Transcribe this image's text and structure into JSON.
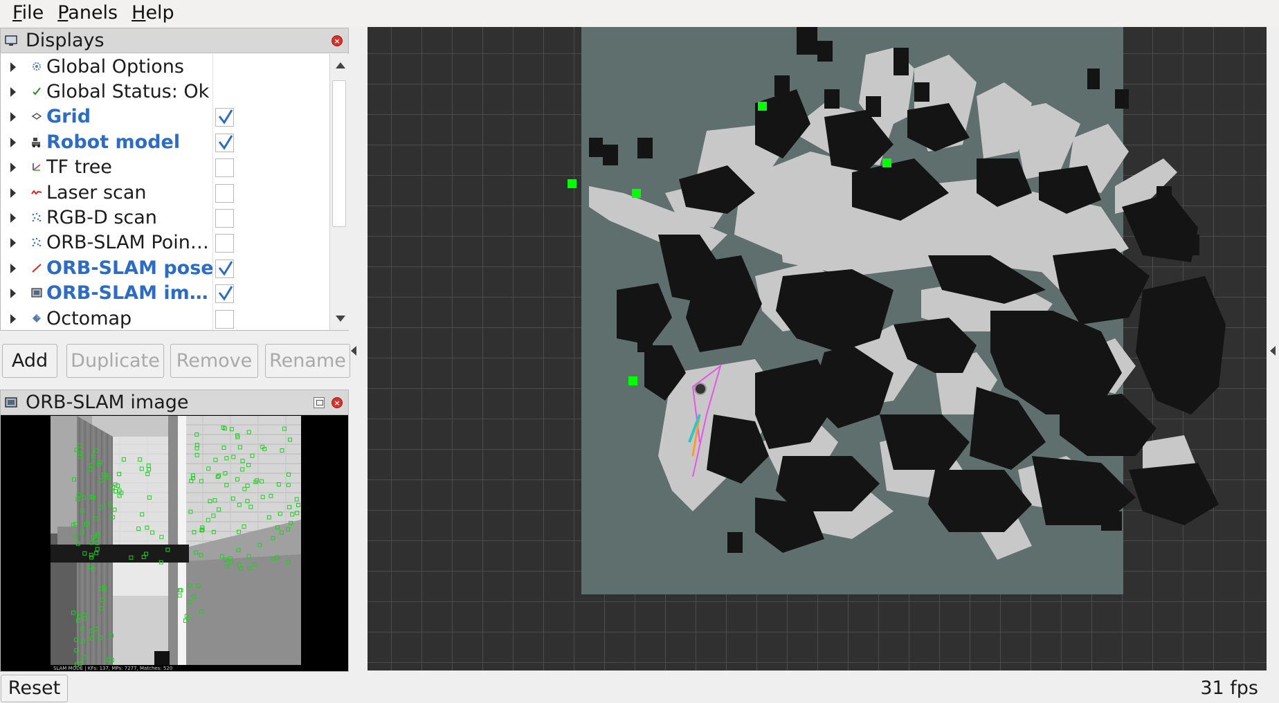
{
  "menubar": {
    "items": [
      {
        "mnemonic": "F",
        "rest": "ile"
      },
      {
        "mnemonic": "P",
        "rest": "anels"
      },
      {
        "mnemonic": "H",
        "rest": "elp"
      }
    ]
  },
  "displays": {
    "title": "Displays",
    "items": [
      {
        "label": "Global Options",
        "icon": "gear-icon",
        "enabled": null
      },
      {
        "label": "Global Status: Ok",
        "icon": "checkmark-icon",
        "enabled": null
      },
      {
        "label": "Grid",
        "icon": "grid-icon",
        "enabled": true
      },
      {
        "label": "Robot model",
        "icon": "robot-icon",
        "enabled": true
      },
      {
        "label": "TF tree",
        "icon": "axes-icon",
        "enabled": false
      },
      {
        "label": "Laser scan",
        "icon": "laser-scan-icon",
        "enabled": false
      },
      {
        "label": "RGB-D scan",
        "icon": "point-cloud-icon",
        "enabled": false
      },
      {
        "label": "ORB-SLAM Poin…",
        "icon": "point-cloud-icon",
        "enabled": false
      },
      {
        "label": "ORB-SLAM pose",
        "icon": "pose-arrow-icon",
        "enabled": true
      },
      {
        "label": "ORB-SLAM im…",
        "icon": "image-icon",
        "enabled": true
      },
      {
        "label": "Octomap",
        "icon": "octomap-icon",
        "enabled": false
      }
    ],
    "buttons": {
      "add": "Add",
      "duplicate": "Duplicate",
      "remove": "Remove",
      "rename": "Rename"
    }
  },
  "image_panel": {
    "title": "ORB-SLAM image",
    "status_line": "SLAM MODE | KFs: 137, MPs: 7277, Matches: 520"
  },
  "statusbar": {
    "reset_label": "Reset",
    "fps": "31 fps"
  },
  "colors": {
    "grid_bg": "#303030",
    "map_unknown": "#5f6f6e",
    "map_free": "#c8c8c8",
    "map_occupied": "#141414",
    "marker": "#00ff00",
    "enabled_text": "#2b6cc4"
  }
}
